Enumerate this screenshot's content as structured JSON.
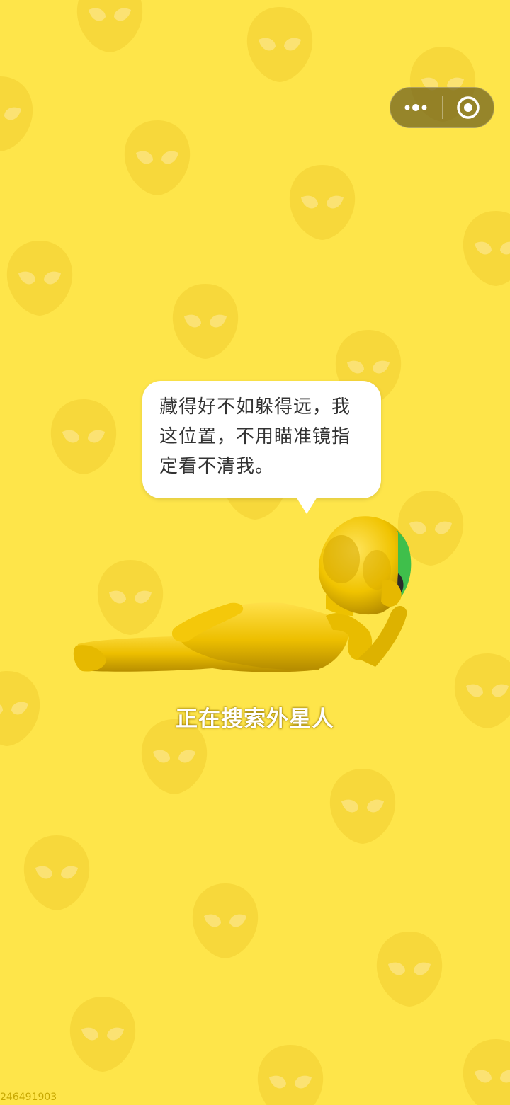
{
  "capsule": {
    "more_icon": "more-dots-icon",
    "close_icon": "target-close-icon"
  },
  "bubble": {
    "text": "藏得好不如躲得远，我这位置，不用瞄准镜指定看不清我。"
  },
  "status": {
    "text": "正在搜索外星人"
  },
  "footer": {
    "id_text": "246491903"
  },
  "colors": {
    "background": "#FEE54A",
    "pattern": "#F7D83B",
    "alien_body": "#F2C400",
    "alien_glasses": "#3FBF4B",
    "bubble": "#FFFFFF",
    "bubble_text": "#333333",
    "status_text": "#FFFFFF"
  }
}
